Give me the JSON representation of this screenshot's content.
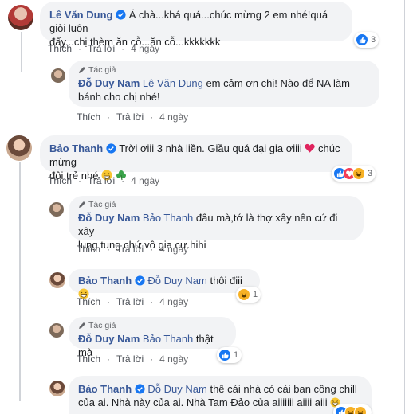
{
  "labels": {
    "like": "Thích",
    "reply": "Trả lời",
    "author_badge": "Tác giả",
    "dot": "·"
  },
  "comments": [
    {
      "name": "Lê Văn Dung",
      "text_line1": "Á chà...khá quá...chúc mừng 2 em nhé!quá giỏi luôn",
      "text_line2": "đấy...chị thèm ăn cỗ...ăn cỗ...kkkkkkk",
      "time": "4 ngày",
      "reaction_count": "3"
    },
    {
      "name": "Đỗ Duy Nam",
      "tag": "Lê Văn Dung",
      "text_line1": "em cảm ơn chị! Nào để NA làm",
      "text_line2": "bánh cho chị nhé!",
      "time": "4 ngày"
    },
    {
      "name": "Bảo Thanh",
      "text_line1": "Trời ơiii 3 nhà liền. Giầu quá đại gia ơiiii",
      "text_after_heart": "chúc mừng",
      "text_line2": "đôi trẻ nhé",
      "time": "4 ngày",
      "reaction_count": "3"
    },
    {
      "name": "Đỗ Duy Nam",
      "tag": "Bảo Thanh",
      "text_line1": "đâu mà,tớ là thợ xây nên cứ đi xây",
      "text_line2": "lung tung chứ vô gia cư.hihi",
      "time": "4 ngày"
    },
    {
      "name": "Bảo Thanh",
      "tag": "Đỗ Duy Nam",
      "text_line1": "thôi điii",
      "time": "4 ngày",
      "reaction_count": "1"
    },
    {
      "name": "Đỗ Duy Nam",
      "tag": "Bảo Thanh",
      "text_line1": "thật mà",
      "time": "4 ngày",
      "reaction_count": "1"
    },
    {
      "name": "Bảo Thanh",
      "tag": "Đỗ Duy Nam",
      "text_line1": "thế cái nhà có cái ban công chill",
      "text_line2": "của ai. Nhà này của ai. Nhà Tam Đảo của aiiiiiii aiiii aiii"
    }
  ],
  "colors": {
    "name": "#385898",
    "bubble": "#f2f3f5",
    "like": "#1877f2",
    "love": "#f33e58",
    "haha": "#f7b125",
    "verified": "#1877f2"
  }
}
